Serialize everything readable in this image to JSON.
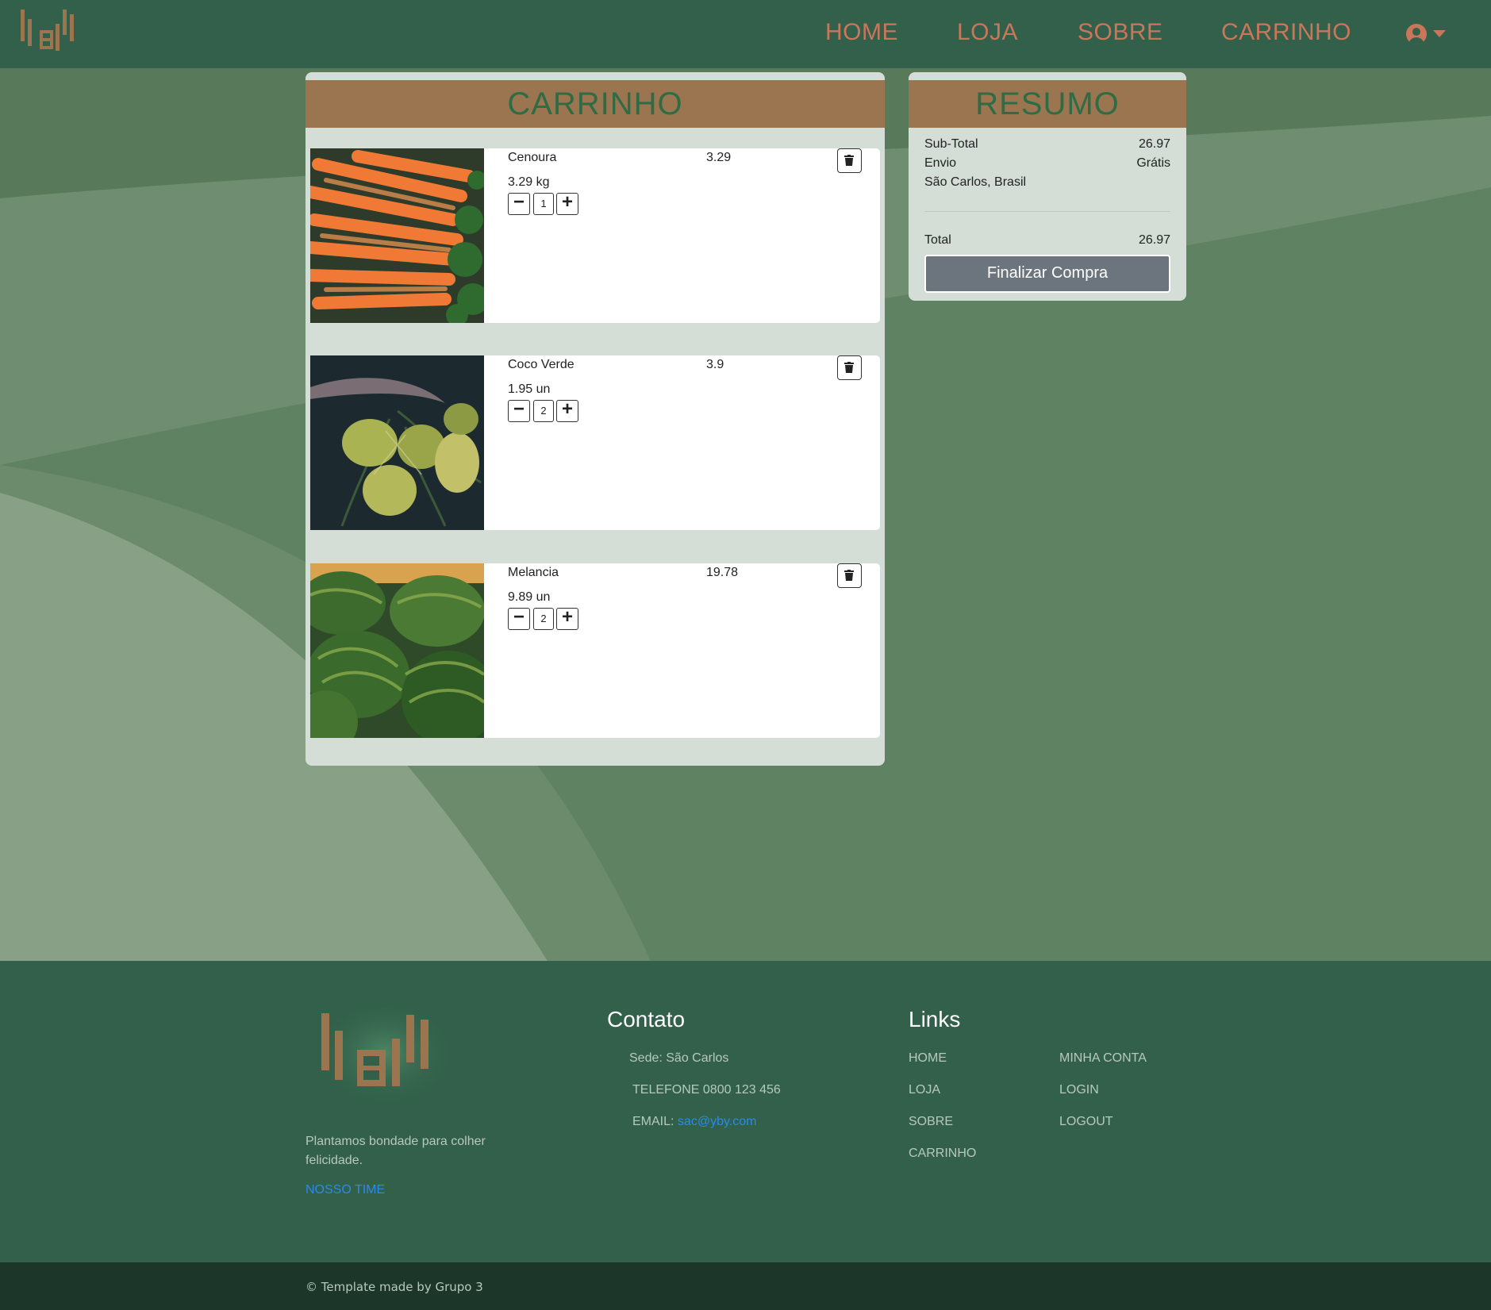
{
  "nav": {
    "links": [
      "HOME",
      "LOJA",
      "SOBRE",
      "CARRINHO"
    ],
    "link_color": "#c9765b",
    "user_icon": "user-circle-icon"
  },
  "cart": {
    "title": "CARRINHO",
    "items": [
      {
        "name": "Cenoura",
        "price": "3.29",
        "unit": "3.29 kg",
        "qty": "1",
        "image": "carrots-photo"
      },
      {
        "name": "Coco Verde",
        "price": "3.9",
        "unit": "1.95 un",
        "qty": "2",
        "image": "coconut-photo"
      },
      {
        "name": "Melancia",
        "price": "19.78",
        "unit": "9.89 un",
        "qty": "2",
        "image": "watermelon-photo"
      }
    ]
  },
  "summary": {
    "title": "RESUMO",
    "subtotal_label": "Sub-Total",
    "subtotal_value": "26.97",
    "shipping_label": "Envio",
    "shipping_value": "Grátis",
    "location": "São Carlos, Brasil",
    "total_label": "Total",
    "total_value": "26.97",
    "checkout_label": "Finalizar Compra"
  },
  "footer": {
    "tagline": "Plantamos bondade para colher felicidade.",
    "team_link": "NOSSO TIME",
    "contact_title": "Contato",
    "contact_address": "Sede: São Carlos",
    "contact_phone": "TELEFONE 0800 123 456",
    "contact_email_label": "EMAIL:",
    "contact_email": "sac@yby.com",
    "links_title": "Links",
    "links_col1": [
      "HOME",
      "LOJA",
      "SOBRE",
      "CARRINHO"
    ],
    "links_col2": [
      "MINHA CONTA",
      "LOGIN",
      "LOGOUT"
    ],
    "copyright": "© Template made by Grupo 3"
  },
  "colors": {
    "header_bg": "#32604a",
    "panel_header": "#9a7550",
    "panel_title": "#2f6c46",
    "checkout_bg": "#6c757d",
    "link_blue": "#2a8be8"
  }
}
